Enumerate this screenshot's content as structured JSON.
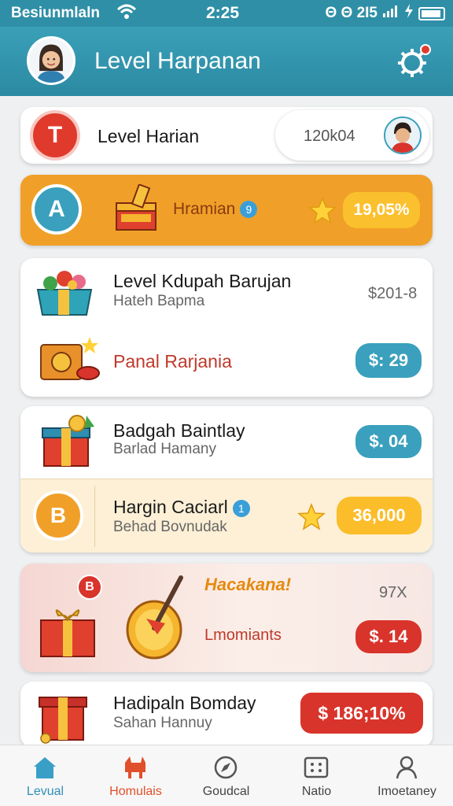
{
  "status_bar": {
    "carrier": "Besiunmlaln",
    "time": "2:25",
    "right_text": "Θ Θ 2I5"
  },
  "header": {
    "title": "Level Harpanan"
  },
  "card1": {
    "badge": "T",
    "label": "Level Harian",
    "value": "120k04"
  },
  "card2": {
    "badge": "A",
    "label": "Hramian",
    "info": "9",
    "value": "19,05%"
  },
  "card3": {
    "row1": {
      "title": "Level Kdupah Barujan",
      "subtitle": "Hateh Bapma",
      "value": "$201-8"
    },
    "row2": {
      "title": "Panal Rarjania",
      "value": "$: 29"
    }
  },
  "card4": {
    "title": "Badgah Baintlay",
    "subtitle": "Barlad Hamany",
    "value": "$. 04"
  },
  "card5": {
    "badge": "B",
    "title": "Hargin Caciarl",
    "info": "1",
    "subtitle": "Behad Bovnudak",
    "value": "36,000"
  },
  "card6": {
    "badge": "B",
    "title": "Hacakana!",
    "multiplier": "97X",
    "label": "Lmomiants",
    "value": "$. 14"
  },
  "card7": {
    "title": "Hadipaln Bomday",
    "subtitle": "Sahan Hannuy",
    "value": "$ 186;10%"
  },
  "tabs": [
    {
      "label": "Levual",
      "icon": "home-icon",
      "active": true
    },
    {
      "label": "Homulais",
      "icon": "pet-icon",
      "active": false
    },
    {
      "label": "Goudcal",
      "icon": "compass-icon",
      "active": false
    },
    {
      "label": "Natio",
      "icon": "grid-icon",
      "active": false
    },
    {
      "label": "Imoetaney",
      "icon": "person-icon",
      "active": false
    }
  ],
  "colors": {
    "teal": "#2f8fa6",
    "orange": "#f0a028",
    "yellow": "#fbb82a",
    "red": "#d8342b",
    "blue_pill": "#3aa0bd",
    "active_tab": "#e0502a"
  }
}
